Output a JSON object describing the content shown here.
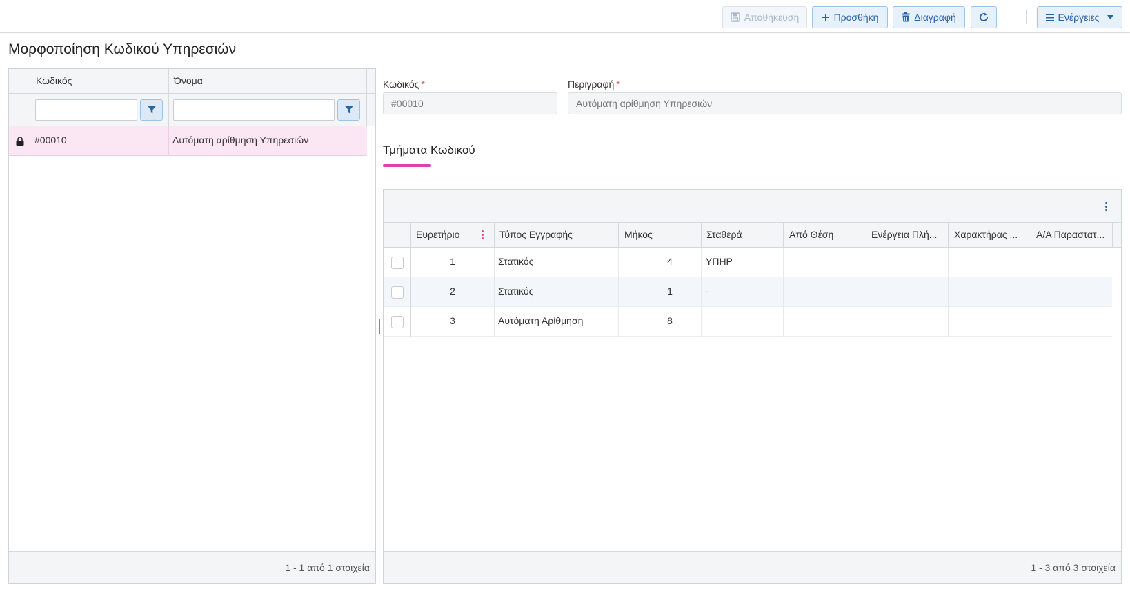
{
  "toolbar": {
    "save_label": "Αποθήκευση",
    "add_label": "Προσθήκη",
    "delete_label": "Διαγραφή",
    "actions_label": "Ενέργειες"
  },
  "page": {
    "title": "Μορφοποίηση Κωδικού Υπηρεσιών"
  },
  "left_grid": {
    "columns": [
      "Κωδικός",
      "Όνομα"
    ],
    "rows": [
      {
        "code": "#00010",
        "name": "Αυτόματη αρίθμηση Υπηρεσιών",
        "locked": true
      }
    ],
    "pager": "1 - 1 από 1 στοιχεία"
  },
  "form": {
    "code_label": "Κωδικός",
    "code_value": "#00010",
    "description_label": "Περιγραφή",
    "description_value": "Αυτόματη αρίθμηση Υπηρεσιών",
    "required_mark": "*"
  },
  "tabs": {
    "active": "Τμήματα Κωδικού"
  },
  "right_grid": {
    "columns": [
      "Ευρετήριο",
      "Τύπος Εγγραφής",
      "Μήκος",
      "Σταθερά",
      "Από Θέση",
      "Ενέργεια Πλή...",
      "Χαρακτήρας ...",
      "Α/Α Παραστατ..."
    ],
    "rows": [
      {
        "index": "1",
        "type": "Στατικός",
        "length": "4",
        "constant": "ΥΠΗΡ"
      },
      {
        "index": "2",
        "type": "Στατικός",
        "length": "1",
        "constant": "-"
      },
      {
        "index": "3",
        "type": "Αυτόματη Αρίθμηση",
        "length": "8",
        "constant": ""
      }
    ],
    "pager": "1 - 3 από 3 στοιχεία"
  },
  "colors": {
    "accent": "#e040b0",
    "button_text": "#2a64a8",
    "selected_row": "#fbe7f4"
  },
  "icons": [
    "save-icon",
    "plus-icon",
    "trash-icon",
    "refresh-icon",
    "menu-icon",
    "caret-down-icon",
    "filter-icon",
    "lock-icon",
    "kebab-icon"
  ]
}
